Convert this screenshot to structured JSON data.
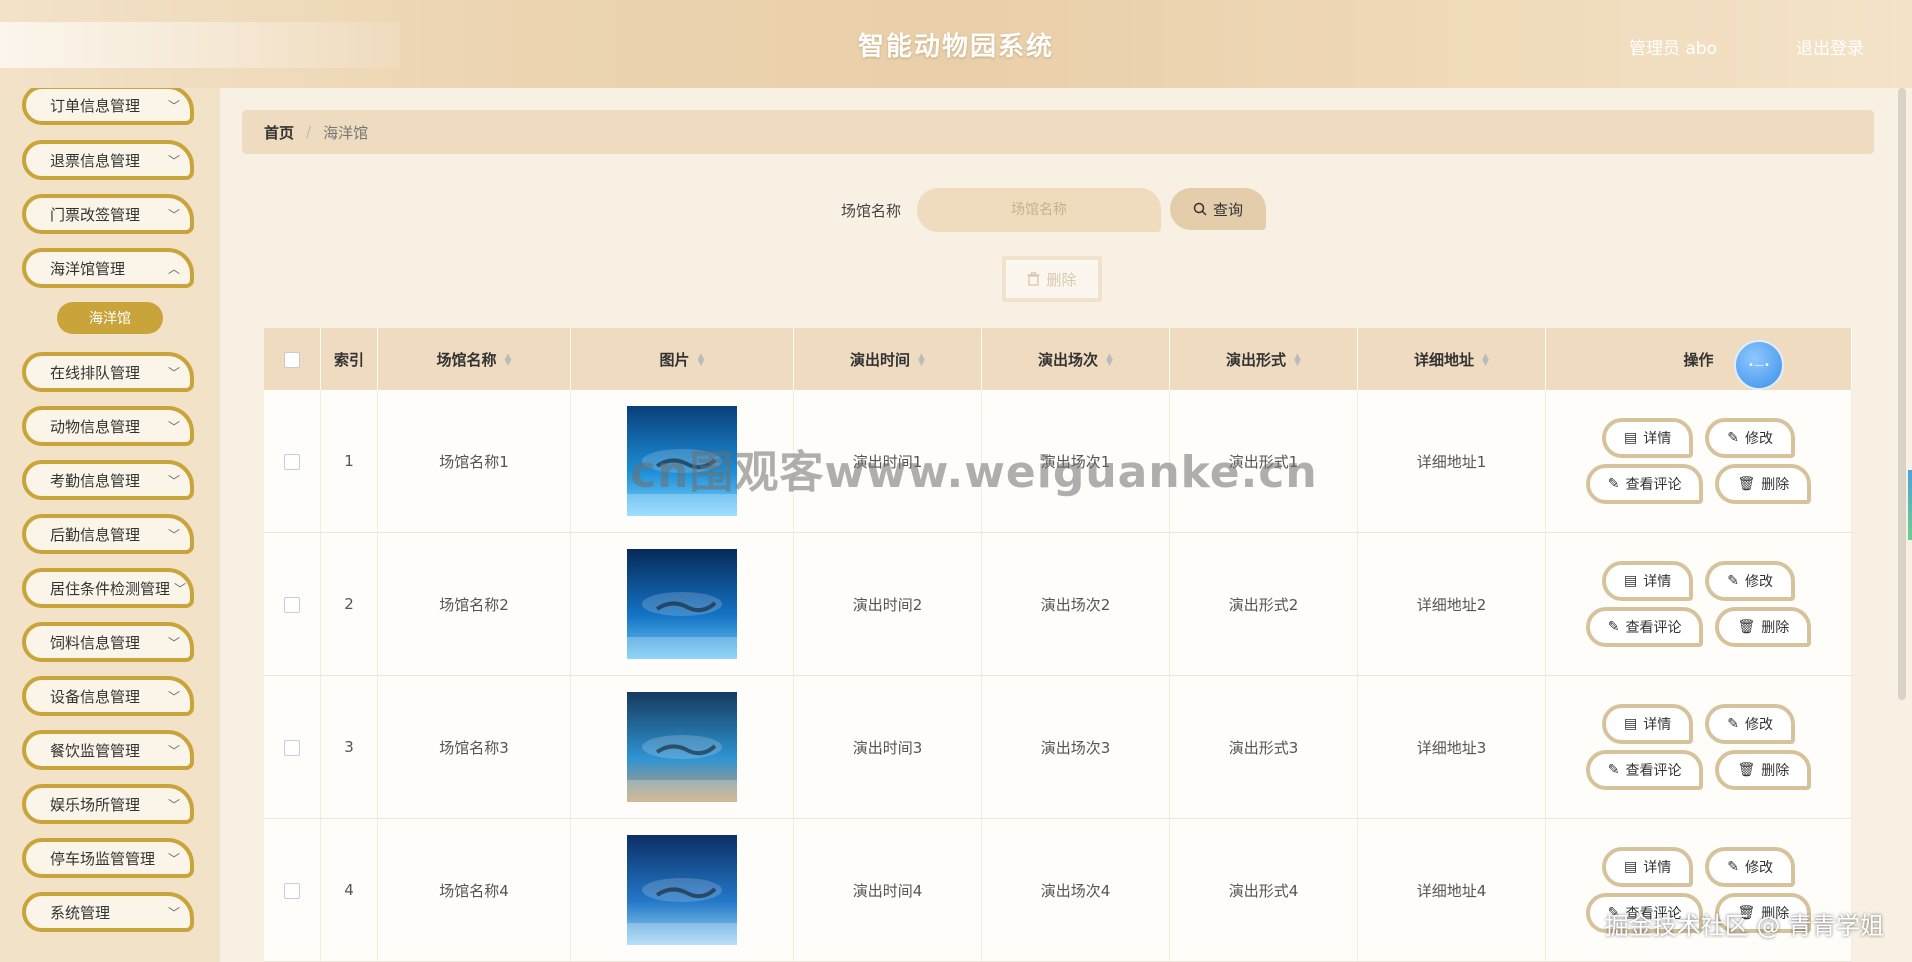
{
  "header": {
    "title": "智能动物园系统",
    "user": "管理员 abo",
    "logout": "退出登录"
  },
  "sidebar": {
    "items": [
      {
        "label": "订单信息管理"
      },
      {
        "label": "退票信息管理"
      },
      {
        "label": "门票改签管理"
      },
      {
        "label": "海洋馆管理"
      },
      {
        "label": "在线排队管理"
      },
      {
        "label": "动物信息管理"
      },
      {
        "label": "考勤信息管理"
      },
      {
        "label": "后勤信息管理"
      },
      {
        "label": "居住条件检测管理"
      },
      {
        "label": "饲料信息管理"
      },
      {
        "label": "设备信息管理"
      },
      {
        "label": "餐饮监管管理"
      },
      {
        "label": "娱乐场所管理"
      },
      {
        "label": "停车场监管管理"
      },
      {
        "label": "系统管理"
      }
    ],
    "sub_item": "海洋馆"
  },
  "breadcrumb": {
    "home": "首页",
    "sep": "/",
    "current": "海洋馆"
  },
  "search": {
    "label": "场馆名称",
    "placeholder": "场馆名称",
    "button": "查询"
  },
  "delete_all": "删除",
  "table": {
    "headers": [
      "索引",
      "场馆名称",
      "图片",
      "演出时间",
      "演出场次",
      "演出形式",
      "详细地址",
      "操作"
    ],
    "rows": [
      {
        "index": "1",
        "name": "场馆名称1",
        "time": "演出时间1",
        "session": "演出场次1",
        "form": "演出形式1",
        "address": "详细地址1"
      },
      {
        "index": "2",
        "name": "场馆名称2",
        "time": "演出时间2",
        "session": "演出场次2",
        "form": "演出形式2",
        "address": "详细地址2"
      },
      {
        "index": "3",
        "name": "场馆名称3",
        "time": "演出时间3",
        "session": "演出场次3",
        "form": "演出形式3",
        "address": "详细地址3"
      },
      {
        "index": "4",
        "name": "场馆名称4",
        "time": "演出时间4",
        "session": "演出场次4",
        "form": "演出形式4",
        "address": "详细地址4"
      }
    ],
    "actions": {
      "detail": "详情",
      "edit": "修改",
      "comments": "查看评论",
      "delete": "删除"
    }
  },
  "watermarks": {
    "center": "cn围观客www.weiguanke.cn",
    "corner": "掘金技术社区 @ 青青学姐"
  },
  "colors": {
    "accent": "#c9a43a",
    "header_bg": "#ecd5b2",
    "table_header": "#efdcc0"
  }
}
